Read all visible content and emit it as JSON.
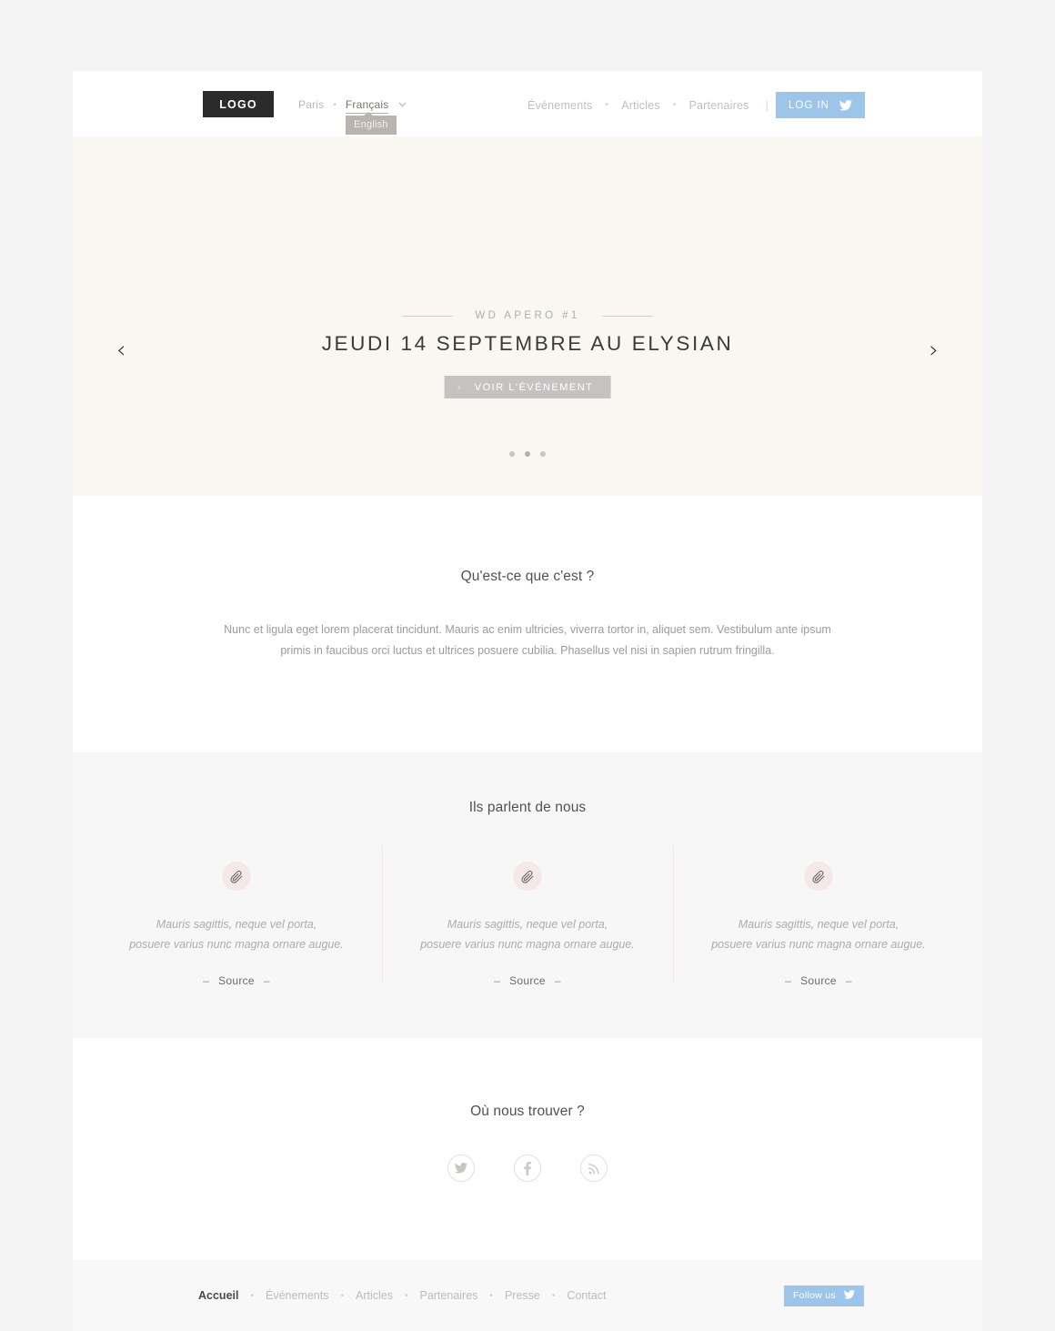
{
  "header": {
    "logo": "LOGO",
    "city": "Paris",
    "separator": "•",
    "language": "Français",
    "caret": "⌄",
    "dropdown_option": "English",
    "nav": [
      {
        "label": "Événements"
      },
      {
        "label": "Articles"
      },
      {
        "label": "Partenaires"
      }
    ],
    "nav_dot": "•",
    "nav_pipe": "|",
    "login_label": "LOG IN",
    "twitter_icon": "twitter-icon"
  },
  "hero": {
    "eyebrow": "WD APERO #1",
    "title": "JEUDI 14 SEPTEMBRE AU ELYSIAN",
    "cta_label": "VOIR L'ÉVÉNEMENT",
    "cta_chevron": "›",
    "prev_arrow": "‹",
    "next_arrow": "›",
    "slide_count": 3,
    "active_slide": 2,
    "background_color": "#faf7f2"
  },
  "about": {
    "title": "Qu'est-ce que c'est ?",
    "body": "Nunc et ligula eget lorem placerat tincidunt. Mauris ac enim ultricies, viverra tortor in, aliquet sem. Vestibulum ante ipsum primis in faucibus orci luctus et ultrices posuere cubilia. Phasellus vel nisi in sapien rutrum fringilla."
  },
  "press": {
    "title": "Ils parlent de nous",
    "cards": [
      {
        "icon": "paperclip-icon",
        "quote_line1": "Mauris sagittis, neque vel porta,",
        "quote_line2": "posuere varius nunc magna ornare augue.",
        "source": "Source",
        "dash": "–"
      },
      {
        "icon": "paperclip-icon",
        "quote_line1": "Mauris sagittis, neque vel porta,",
        "quote_line2": "posuere varius nunc magna ornare augue.",
        "source": "Source",
        "dash": "–"
      },
      {
        "icon": "paperclip-icon",
        "quote_line1": "Mauris sagittis, neque vel porta,",
        "quote_line2": "posuere varius nunc magna ornare augue.",
        "source": "Source",
        "dash": "–"
      }
    ]
  },
  "social": {
    "title": "Où nous trouver ?",
    "links": [
      {
        "name": "twitter-icon"
      },
      {
        "name": "facebook-icon"
      },
      {
        "name": "rss-icon"
      }
    ]
  },
  "footer": {
    "nav": [
      {
        "label": "Accueil",
        "active": true
      },
      {
        "label": "Événements",
        "active": false
      },
      {
        "label": "Articles",
        "active": false
      },
      {
        "label": "Partenaires",
        "active": false
      },
      {
        "label": "Presse",
        "active": false
      },
      {
        "label": "Contact",
        "active": false
      }
    ],
    "dot": "•",
    "follow_label": "Follow us",
    "twitter_icon": "twitter-icon"
  },
  "colors": {
    "accent_blue": "#9cc5e9",
    "hero_cream": "#faf7f2",
    "press_gray": "#f7f7f7",
    "page_gray": "#f4f4f4",
    "logo_black": "#2b2b2b"
  }
}
